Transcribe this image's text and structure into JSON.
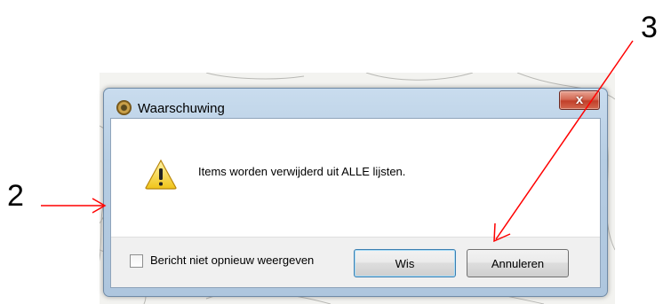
{
  "annotations": {
    "label_2": "2",
    "label_3": "3",
    "arrow_color": "#ff0000"
  },
  "dialog": {
    "title": "Waarschuwing",
    "close_symbol": "x",
    "message": "Items worden verwijderd uit ALLE lijsten.",
    "checkbox_label": "Bericht niet opnieuw weergeven",
    "checkbox_checked": false,
    "primary_button_label": "Wis",
    "cancel_button_label": "Annuleren",
    "icons": {
      "app": "app-icon",
      "warning": "warning-icon",
      "close": "close-icon"
    }
  }
}
